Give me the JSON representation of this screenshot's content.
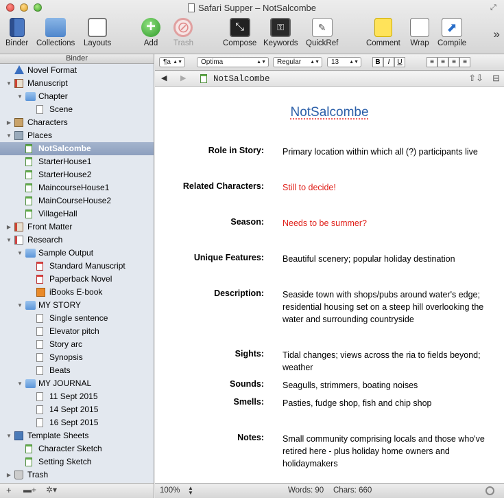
{
  "window": {
    "title": "Safari Supper – NotSalcombe"
  },
  "toolbar": {
    "binder": "Binder",
    "collections": "Collections",
    "layouts": "Layouts",
    "add": "Add",
    "trash": "Trash",
    "compose": "Compose",
    "keywords": "Keywords",
    "quickref": "QuickRef",
    "comment": "Comment",
    "wrap": "Wrap",
    "compile": "Compile"
  },
  "binder": {
    "header": "Binder",
    "items": [
      {
        "label": "Novel Format",
        "icon": "novel-format-icon"
      },
      {
        "label": "Manuscript",
        "icon": "manuscript-icon"
      },
      {
        "label": "Chapter",
        "icon": "folder-icon"
      },
      {
        "label": "Scene",
        "icon": "document-icon"
      },
      {
        "label": "Characters",
        "icon": "characters-icon"
      },
      {
        "label": "Places",
        "icon": "places-icon"
      },
      {
        "label": "NotSalcombe",
        "icon": "place-sheet-icon"
      },
      {
        "label": "StarterHouse1",
        "icon": "place-sheet-icon"
      },
      {
        "label": "StarterHouse2",
        "icon": "place-sheet-icon"
      },
      {
        "label": "MaincourseHouse1",
        "icon": "place-sheet-icon"
      },
      {
        "label": "MainCourseHouse2",
        "icon": "place-sheet-icon"
      },
      {
        "label": "VillageHall",
        "icon": "place-sheet-icon"
      },
      {
        "label": "Front Matter",
        "icon": "front-matter-icon"
      },
      {
        "label": "Research",
        "icon": "research-icon"
      },
      {
        "label": "Sample Output",
        "icon": "folder-icon"
      },
      {
        "label": "Standard Manuscript",
        "icon": "pdf-icon"
      },
      {
        "label": "Paperback Novel",
        "icon": "pdf-icon"
      },
      {
        "label": "iBooks E-book",
        "icon": "ibooks-icon"
      },
      {
        "label": "MY STORY",
        "icon": "folder-icon"
      },
      {
        "label": "Single sentence",
        "icon": "document-icon"
      },
      {
        "label": "Elevator pitch",
        "icon": "document-icon"
      },
      {
        "label": "Story arc",
        "icon": "document-icon"
      },
      {
        "label": "Synopsis",
        "icon": "document-icon"
      },
      {
        "label": "Beats",
        "icon": "document-icon"
      },
      {
        "label": "MY JOURNAL",
        "icon": "folder-icon"
      },
      {
        "label": "11 Sept 2015",
        "icon": "document-icon"
      },
      {
        "label": "14 Sept 2015",
        "icon": "document-icon"
      },
      {
        "label": "16 Sept 2015",
        "icon": "document-icon"
      },
      {
        "label": "Template Sheets",
        "icon": "template-sheets-icon"
      },
      {
        "label": "Character Sketch",
        "icon": "template-icon"
      },
      {
        "label": "Setting Sketch",
        "icon": "template-icon"
      },
      {
        "label": "Trash",
        "icon": "trash-icon"
      }
    ]
  },
  "formatbar": {
    "paragraph": "¶a",
    "font": "Optima",
    "style": "Regular",
    "size": "13",
    "bold": "B",
    "italic": "I",
    "underline": "U"
  },
  "navbar": {
    "title": "NotSalcombe"
  },
  "document": {
    "title": "NotSalcombe",
    "fields": [
      {
        "label": "Role in Story:",
        "value": "Primary location within which all (?) participants live",
        "color": "#000000"
      },
      {
        "label": "Related Characters:",
        "value": "Still to decide!",
        "color": "#e0201a"
      },
      {
        "label": "Season:",
        "value": "Needs to be summer?",
        "color": "#e0201a"
      },
      {
        "label": "Unique Features:",
        "value": "Beautiful scenery; popular holiday destination",
        "color": "#000000"
      },
      {
        "label": "Description:",
        "value": "Seaside town with shops/pubs around water's edge; residential housing set on a steep hill overlooking the water and surrounding countryside",
        "color": "#000000"
      },
      {
        "label": "Sights:",
        "value": "Tidal changes; views across the ria to fields beyond; weather",
        "color": "#000000"
      },
      {
        "label": "Sounds:",
        "value": "Seagulls, strimmers, boating noises",
        "color": "#000000"
      },
      {
        "label": "Smells:",
        "value": "Pasties, fudge shop, fish and chip shop",
        "color": "#000000"
      },
      {
        "label": "Notes:",
        "value": "Small community comprising locals and those who've retired here - plus holiday home owners and holidaymakers",
        "color": "#000000"
      }
    ]
  },
  "statusbar": {
    "zoom": "100%",
    "words": "Words: 90",
    "chars": "Chars: 660"
  }
}
